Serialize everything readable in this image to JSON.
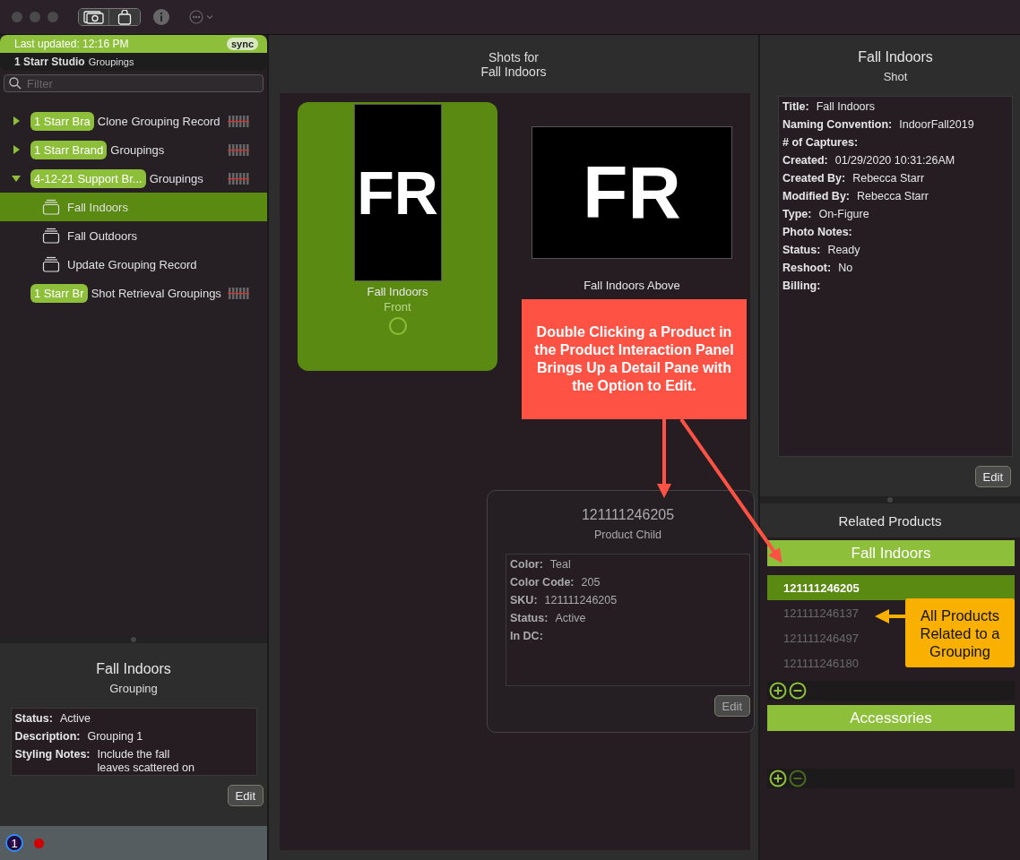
{
  "sidebar": {
    "last_updated": "Last updated: 12:16 PM",
    "sync_button": "sync",
    "studio": {
      "name": "1 Starr Studio",
      "suffix": "Groupings"
    },
    "filter": {
      "placeholder": "Filter"
    },
    "tree": [
      {
        "tag": "1 Starr Bra",
        "label": "Clone Grouping Record",
        "expanded": false
      },
      {
        "tag": "1 Starr Brand",
        "label": "Groupings",
        "expanded": false
      },
      {
        "tag": "4-12-21 Support Br...",
        "label": "Groupings",
        "expanded": true,
        "children": [
          {
            "label": "Fall Indoors",
            "selected": true
          },
          {
            "label": "Fall Outdoors",
            "selected": false
          },
          {
            "label": "Update Grouping Record",
            "selected": false
          }
        ]
      },
      {
        "tag": "1 Starr Br",
        "label": "Shot Retrieval Groupings"
      }
    ]
  },
  "grouping_detail": {
    "title": "Fall Indoors",
    "subtitle": "Grouping",
    "fields": [
      {
        "label": "Status:",
        "value": "Active"
      },
      {
        "label": "Description:",
        "value": "Grouping 1"
      },
      {
        "label": "Styling Notes:",
        "value": "Include the fall leaves scattered on"
      }
    ],
    "edit_button": "Edit"
  },
  "status_bar": {
    "badge": "1"
  },
  "shots": {
    "title": "Shots for",
    "subtitle": "Fall Indoors",
    "items": [
      {
        "kind": "portrait",
        "thumbnail": "FR",
        "name": "Fall Indoors",
        "view": "Front",
        "selected": true
      },
      {
        "kind": "landscape",
        "thumbnail": "FR",
        "name": "Fall Indoors Above",
        "selected": false
      }
    ]
  },
  "product_popover": {
    "title": "121111246205",
    "subtitle": "Product Child",
    "fields": [
      {
        "label": "Color:",
        "value": "Teal"
      },
      {
        "label": "Color Code:",
        "value": "205"
      },
      {
        "label": "SKU:",
        "value": "121111246205"
      },
      {
        "label": "Status:",
        "value": "Active"
      },
      {
        "label": "In DC:"
      }
    ],
    "edit_button": "Edit"
  },
  "shot_detail": {
    "title": "Fall Indoors",
    "subtitle": "Shot",
    "fields": [
      {
        "label": "Title:",
        "value": "Fall Indoors"
      },
      {
        "label": "Naming Convention:",
        "value": "IndoorFall2019"
      },
      {
        "label": "# of Captures:"
      },
      {
        "label": "Created:",
        "value": "01/29/2020 10:31:26AM"
      },
      {
        "label": "Created By:",
        "value": "Rebecca Starr"
      },
      {
        "label": "Modified By:",
        "value": "Rebecca Starr"
      },
      {
        "label": "Type:",
        "value": "On-Figure"
      },
      {
        "label": "Photo Notes:"
      },
      {
        "label": "Status:",
        "value": "Ready"
      },
      {
        "label": "Reshoot:",
        "value": "No"
      },
      {
        "label": "Billing:"
      }
    ],
    "edit_button": "Edit"
  },
  "related_products": {
    "title": "Related Products",
    "sections": [
      {
        "name": "Fall Indoors",
        "remove_enabled": true,
        "products": [
          {
            "sku": "121111246205",
            "selected": true
          },
          {
            "sku": "121111246137",
            "selected": false
          },
          {
            "sku": "121111246497",
            "selected": false
          },
          {
            "sku": "121111246180",
            "selected": false
          }
        ]
      },
      {
        "name": "Accessories",
        "remove_enabled": false
      }
    ]
  },
  "annotations": [
    {
      "kind": "callout",
      "text": "Double Clicking a Product in the Product Interaction Panel Brings Up a Detail Pane with the Option to Edit.",
      "color": "#fd5244"
    },
    {
      "kind": "note",
      "text": "All Products Related to a Grouping",
      "color": "#f9b000"
    }
  ]
}
